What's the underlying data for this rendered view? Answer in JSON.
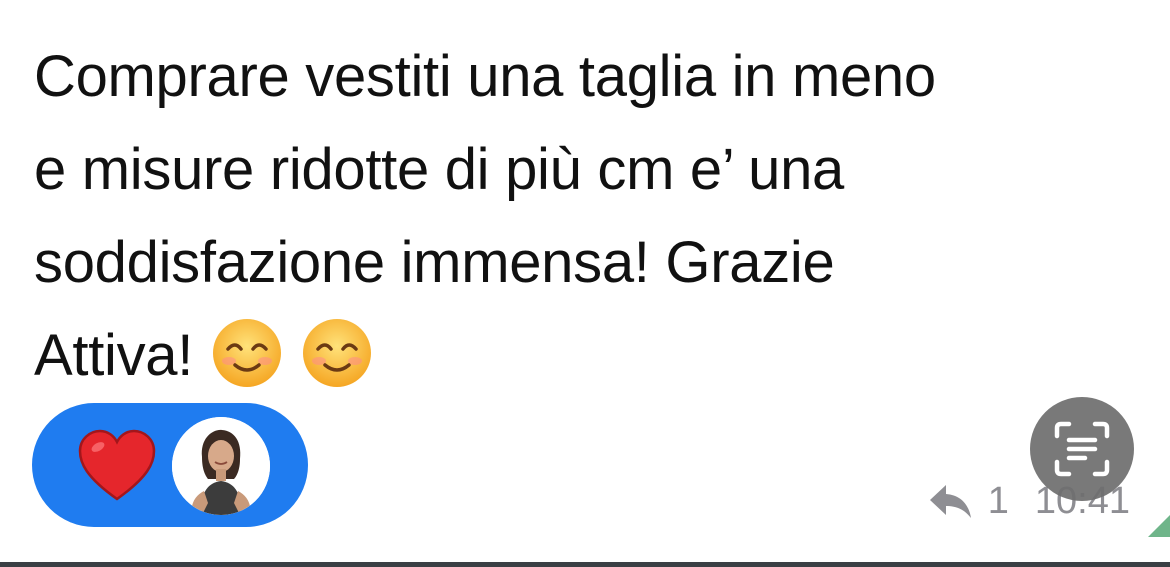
{
  "message": {
    "lines": [
      "Comprare vestiti una taglia in meno",
      "e misure ridotte di più cm e’ una",
      "soddisfazione immensa! Grazie",
      "Attiva!"
    ],
    "emojis": [
      "smiling-face-with-smiling-eyes",
      "smiling-face-with-smiling-eyes"
    ]
  },
  "reaction": {
    "emoji": "red-heart",
    "pill_color": "#1f7cf0"
  },
  "meta": {
    "reply_count": "1",
    "timestamp": "10:41"
  },
  "colors": {
    "text": "#111111",
    "meta": "#8e8e93",
    "heart": "#e5262c",
    "emoji_face": "#ffc93c"
  }
}
